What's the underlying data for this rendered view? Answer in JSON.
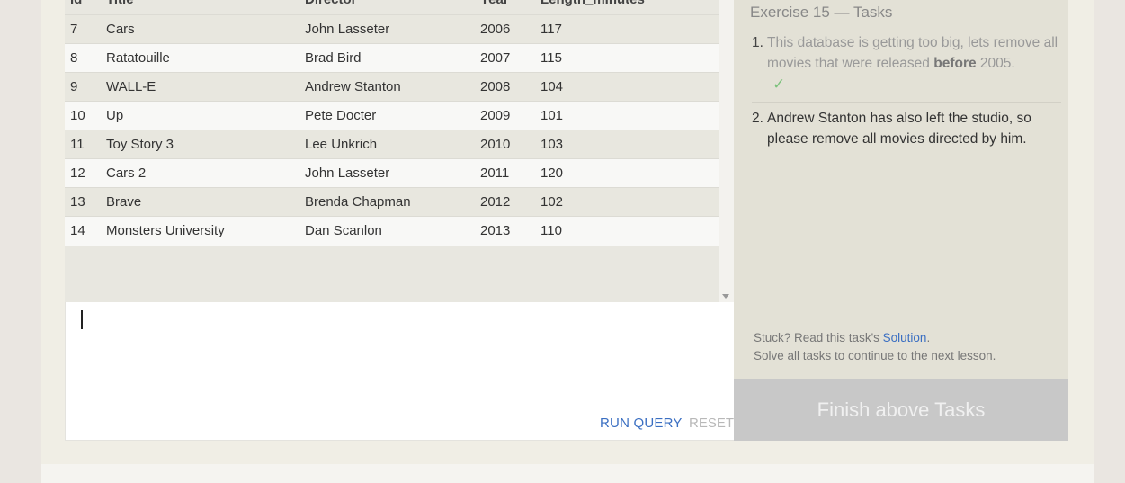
{
  "results_table": {
    "columns": [
      "Id",
      "Title",
      "Director",
      "Year",
      "Length_minutes"
    ],
    "rows": [
      [
        "7",
        "Cars",
        "John Lasseter",
        "2006",
        "117"
      ],
      [
        "8",
        "Ratatouille",
        "Brad Bird",
        "2007",
        "115"
      ],
      [
        "9",
        "WALL-E",
        "Andrew Stanton",
        "2008",
        "104"
      ],
      [
        "10",
        "Up",
        "Pete Docter",
        "2009",
        "101"
      ],
      [
        "11",
        "Toy Story 3",
        "Lee Unkrich",
        "2010",
        "103"
      ],
      [
        "12",
        "Cars 2",
        "John Lasseter",
        "2011",
        "120"
      ],
      [
        "13",
        "Brave",
        "Brenda Chapman",
        "2012",
        "102"
      ],
      [
        "14",
        "Monsters University",
        "Dan Scanlon",
        "2013",
        "110"
      ]
    ]
  },
  "editor": {
    "run_label": "RUN QUERY",
    "reset_label": "RESET"
  },
  "tasks": {
    "title": "Exercise 15 — Tasks",
    "items": [
      {
        "number": "1.",
        "text_before": "This database is getting too big, lets remove all movies that were released ",
        "text_bold": "before",
        "text_after": " 2005.",
        "check": "✓",
        "completed": true
      },
      {
        "number": "2.",
        "text": "Andrew Stanton has also left the studio, so please remove all movies directed by him.",
        "completed": false
      }
    ],
    "help_prefix": "Stuck? Read this task's ",
    "help_link": "Solution",
    "help_suffix": ".",
    "help_line2": "Solve all tasks to continue to the next lesson.",
    "finish_label": "Finish above Tasks"
  },
  "colors": {
    "accent_link": "#3b6fc2",
    "check": "#7cc27c",
    "finish_disabled": "#c8c8c8"
  }
}
